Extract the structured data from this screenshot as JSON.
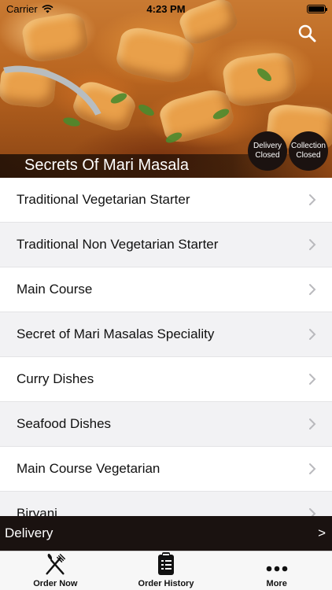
{
  "status_bar": {
    "carrier": "Carrier",
    "time": "4:23 PM"
  },
  "hero": {
    "title": "Secrets Of Mari Masala",
    "delivery_status": "Delivery\nClosed",
    "collection_status": "Collection\nClosed"
  },
  "menu": {
    "items": [
      {
        "label": "Traditional Vegetarian Starter"
      },
      {
        "label": "Traditional Non Vegetarian Starter"
      },
      {
        "label": "Main Course"
      },
      {
        "label": "Secret of Mari Masalas Speciality"
      },
      {
        "label": "Curry Dishes"
      },
      {
        "label": "Seafood Dishes"
      },
      {
        "label": "Main Course Vegetarian"
      },
      {
        "label": "Biryani"
      }
    ]
  },
  "delivery_bar": {
    "label": "Delivery",
    "arrow": ">"
  },
  "tab_bar": {
    "tabs": [
      {
        "label": "Order Now",
        "icon": "fork-knife-icon"
      },
      {
        "label": "Order History",
        "icon": "clipboard-icon"
      },
      {
        "label": "More",
        "icon": "more-dots-icon"
      }
    ]
  },
  "colors": {
    "dark_bar": "#1a1210",
    "alt_row": "#f2f2f4"
  }
}
